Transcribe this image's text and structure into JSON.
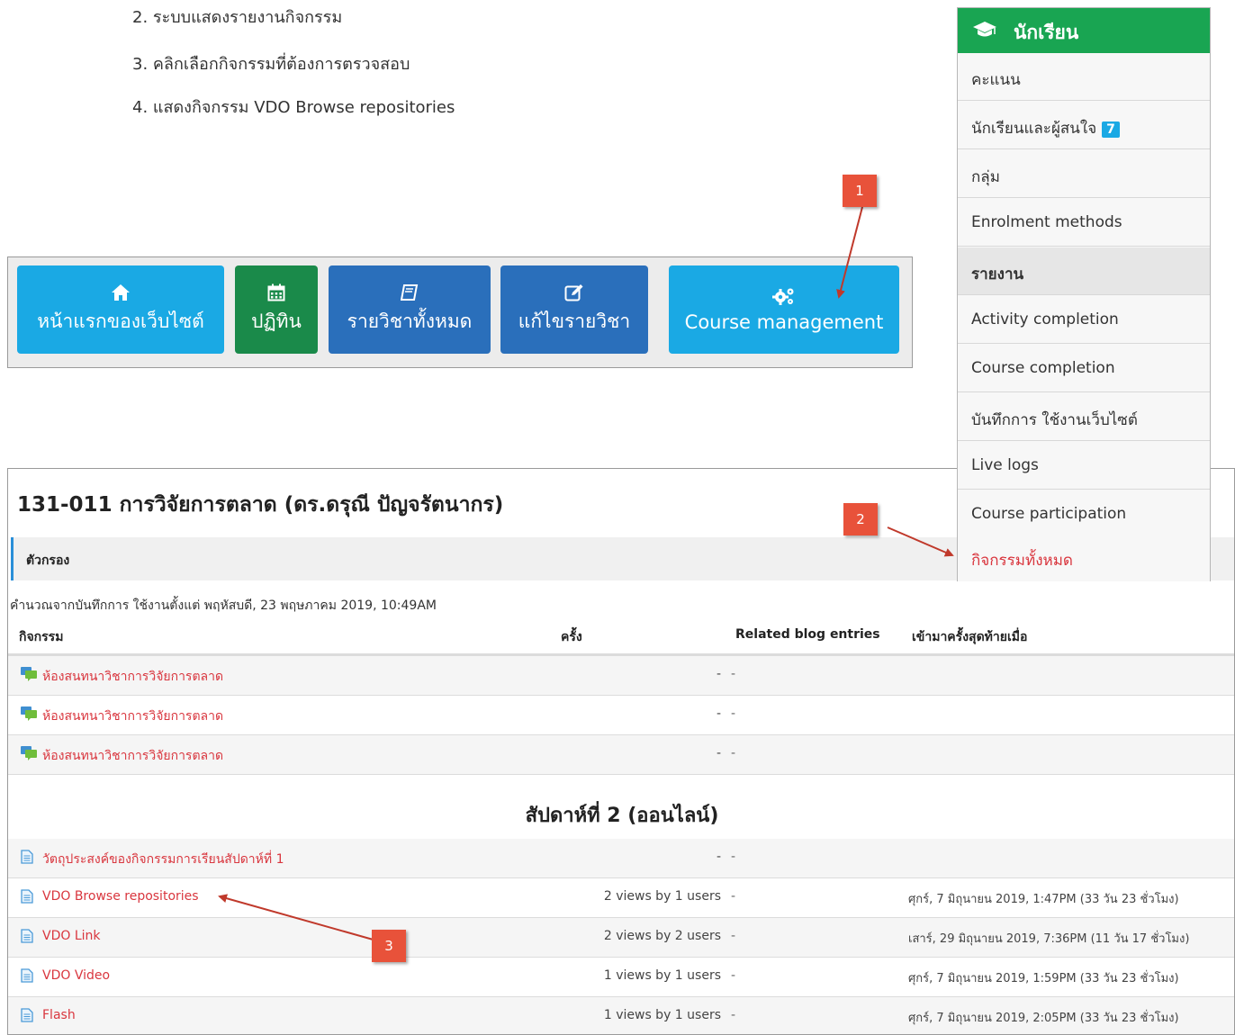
{
  "steps": [
    "2. ระบบแสดงรายงานกิจกรรม",
    "3. คลิกเลือกกิจกรรมที่ต้องการตรวจสอบ",
    "4. แสดงกิจกรรม VDO Browse repositories"
  ],
  "navbar": {
    "home_label": "หน้าแรกของเว็บไซต์",
    "calendar_label": "ปฏิทิน",
    "courses_label": "รายวิชาทั้งหมด",
    "edit_label": "แก้ไขรายวิชา",
    "manage_label": "Course management",
    "icons": [
      "home-icon",
      "calendar-icon",
      "book-icon",
      "edit-icon",
      "gears-icon"
    ]
  },
  "sidemenu": {
    "title": "นักเรียน",
    "title_icon": "graduation-cap-icon",
    "items": [
      {
        "label": "คะแนน"
      },
      {
        "label": "นักเรียนและผู้สนใจ",
        "badge": "7"
      },
      {
        "label": "กลุ่ม"
      },
      {
        "label": "Enrolment methods"
      },
      {
        "label": "รายงาน",
        "state": "active"
      },
      {
        "label": "Activity completion"
      },
      {
        "label": "Course completion"
      },
      {
        "label": "บันทึกการ ใช้งานเว็บไซต์"
      },
      {
        "label": "Live logs"
      },
      {
        "label": "Course participation"
      },
      {
        "label": "กิจกรรมทั้งหมด",
        "state": "highlight"
      }
    ]
  },
  "report": {
    "course_title": "131-011 การวิจัยการตลาด (ดร.ดรุณี ปัญจรัตนากร)",
    "filter_label": "ตัวกรอง",
    "calc_note": "คำนวณจากบันทึกการ ใช้งานตั้งแต่ พฤหัสบดี, 23 พฤษภาคม 2019, 10:49AM",
    "columns": [
      "กิจกรรม",
      "ครั้ง",
      "Related blog entries",
      "เข้ามาครั้งสุดท้ายเมื่อ"
    ],
    "forum_rows": [
      {
        "name": "ห้องสนทนาวิชาการวิจัยการตลาด",
        "views": "-",
        "blog": "-",
        "last": "",
        "icon": "forum-icon"
      },
      {
        "name": "ห้องสนทนาวิชาการวิจัยการตลาด",
        "views": "-",
        "blog": "-",
        "last": "",
        "icon": "forum-icon"
      },
      {
        "name": "ห้องสนทนาวิชาการวิจัยการตลาด",
        "views": "-",
        "blog": "-",
        "last": "",
        "icon": "forum-icon"
      }
    ],
    "section_title": "สัปดาห์ที่ 2 (ออนไลน์)",
    "page_rows": [
      {
        "name": "วัตถุประสงค์ของกิจกรรมการเรียนสัปดาห์ที่ 1",
        "views": "-",
        "blog": "-",
        "last": "",
        "icon": "page-icon"
      },
      {
        "name": "VDO Browse repositories",
        "views": "2 views by 1 users",
        "blog": "-",
        "last": "ศุกร์, 7 มิถุนายน 2019, 1:47PM (33 วัน 23 ชั่วโมง)",
        "icon": "page-icon"
      },
      {
        "name": "VDO Link",
        "views": "2 views by 2 users",
        "blog": "-",
        "last": "เสาร์, 29 มิถุนายน 2019, 7:36PM (11 วัน 17 ชั่วโมง)",
        "icon": "page-icon"
      },
      {
        "name": "VDO Video",
        "views": "1 views by 1 users",
        "blog": "-",
        "last": "ศุกร์, 7 มิถุนายน 2019, 1:59PM (33 วัน 23 ชั่วโมง)",
        "icon": "page-icon"
      },
      {
        "name": "Flash",
        "views": "1 views by 1 users",
        "blog": "-",
        "last": "ศุกร์, 7 มิถุนายน 2019, 2:05PM (33 วัน 23 ชั่วโมง)",
        "icon": "page-icon"
      }
    ]
  },
  "callouts": [
    "1",
    "2",
    "3"
  ],
  "colors": {
    "accent_red": "#d9363e",
    "callout": "#e8523a",
    "menu_green": "#19a552",
    "nav_light_blue": "#1aa9e4",
    "nav_green": "#1a8a4a",
    "nav_blue": "#2a6fbb"
  }
}
